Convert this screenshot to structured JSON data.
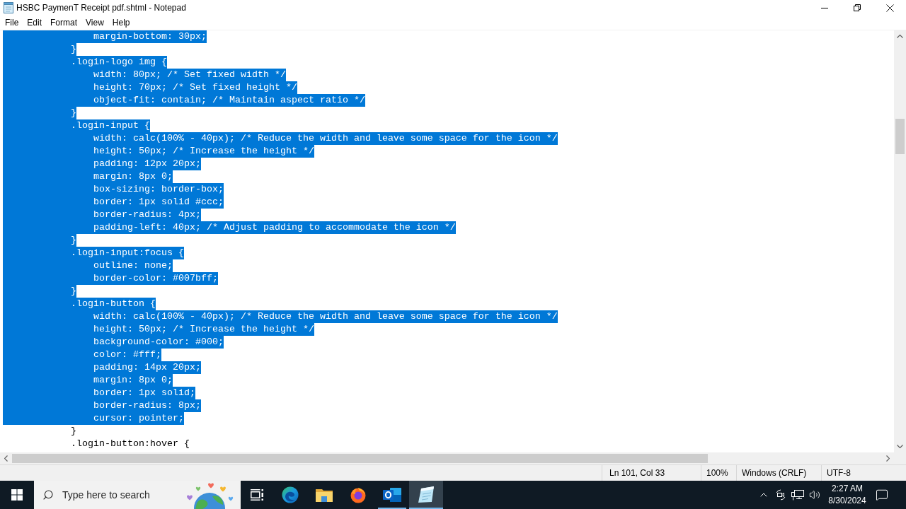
{
  "window": {
    "title": "HSBC PaymenT Receipt pdf.shtml - Notepad"
  },
  "menu": [
    "File",
    "Edit",
    "Format",
    "View",
    "Help"
  ],
  "editor": {
    "lines": [
      {
        "text": "                margin-bottom: 30px;",
        "selected": true
      },
      {
        "text": "            }",
        "selected": true
      },
      {
        "text": "            .login-logo img {",
        "selected": true
      },
      {
        "text": "                width: 80px; /* Set fixed width */",
        "selected": true
      },
      {
        "text": "                height: 70px; /* Set fixed height */",
        "selected": true
      },
      {
        "text": "                object-fit: contain; /* Maintain aspect ratio */",
        "selected": true
      },
      {
        "text": "            }",
        "selected": true
      },
      {
        "text": "            .login-input {",
        "selected": true
      },
      {
        "text": "                width: calc(100% - 40px); /* Reduce the width and leave some space for the icon */",
        "selected": true
      },
      {
        "text": "                height: 50px; /* Increase the height */",
        "selected": true
      },
      {
        "text": "                padding: 12px 20px;",
        "selected": true
      },
      {
        "text": "                margin: 8px 0;",
        "selected": true
      },
      {
        "text": "                box-sizing: border-box;",
        "selected": true
      },
      {
        "text": "                border: 1px solid #ccc;",
        "selected": true
      },
      {
        "text": "                border-radius: 4px;",
        "selected": true
      },
      {
        "text": "                padding-left: 40px; /* Adjust padding to accommodate the icon */",
        "selected": true
      },
      {
        "text": "            }",
        "selected": true
      },
      {
        "text": "            .login-input:focus {",
        "selected": true
      },
      {
        "text": "                outline: none;",
        "selected": true
      },
      {
        "text": "                border-color: #007bff;",
        "selected": true
      },
      {
        "text": "            }",
        "selected": true
      },
      {
        "text": "            .login-button {",
        "selected": true
      },
      {
        "text": "                width: calc(100% - 40px); /* Reduce the width and leave some space for the icon */",
        "selected": true
      },
      {
        "text": "                height: 50px; /* Increase the height */",
        "selected": true
      },
      {
        "text": "                background-color: #000;",
        "selected": true
      },
      {
        "text": "                color: #fff;",
        "selected": true
      },
      {
        "text": "                padding: 14px 20px;",
        "selected": true
      },
      {
        "text": "                margin: 8px 0;",
        "selected": true
      },
      {
        "text": "                border: 1px solid;",
        "selected": true
      },
      {
        "text": "                border-radius: 8px;",
        "selected": true
      },
      {
        "text": "                cursor: pointer;",
        "selected": true
      },
      {
        "text": "            }",
        "selected": false
      },
      {
        "text": "            .login-button:hover {",
        "selected": false
      }
    ]
  },
  "status_bar": [
    "Ln 101, Col 33",
    "100%",
    "Windows (CRLF)",
    "UTF-8"
  ],
  "taskbar": {
    "search": {
      "placeholder": "Type here to search"
    },
    "apps": [
      {
        "kind": "browser",
        "running": false,
        "active": false
      },
      {
        "kind": "folder",
        "running": false,
        "active": false
      },
      {
        "kind": "fox_browser",
        "running": false,
        "active": false
      },
      {
        "kind": "mail",
        "running": true,
        "active": false
      },
      {
        "kind": "notepad",
        "running": true,
        "active": true
      }
    ],
    "clock": {
      "time": "2:27 AM",
      "date": "8/30/2024"
    }
  }
}
